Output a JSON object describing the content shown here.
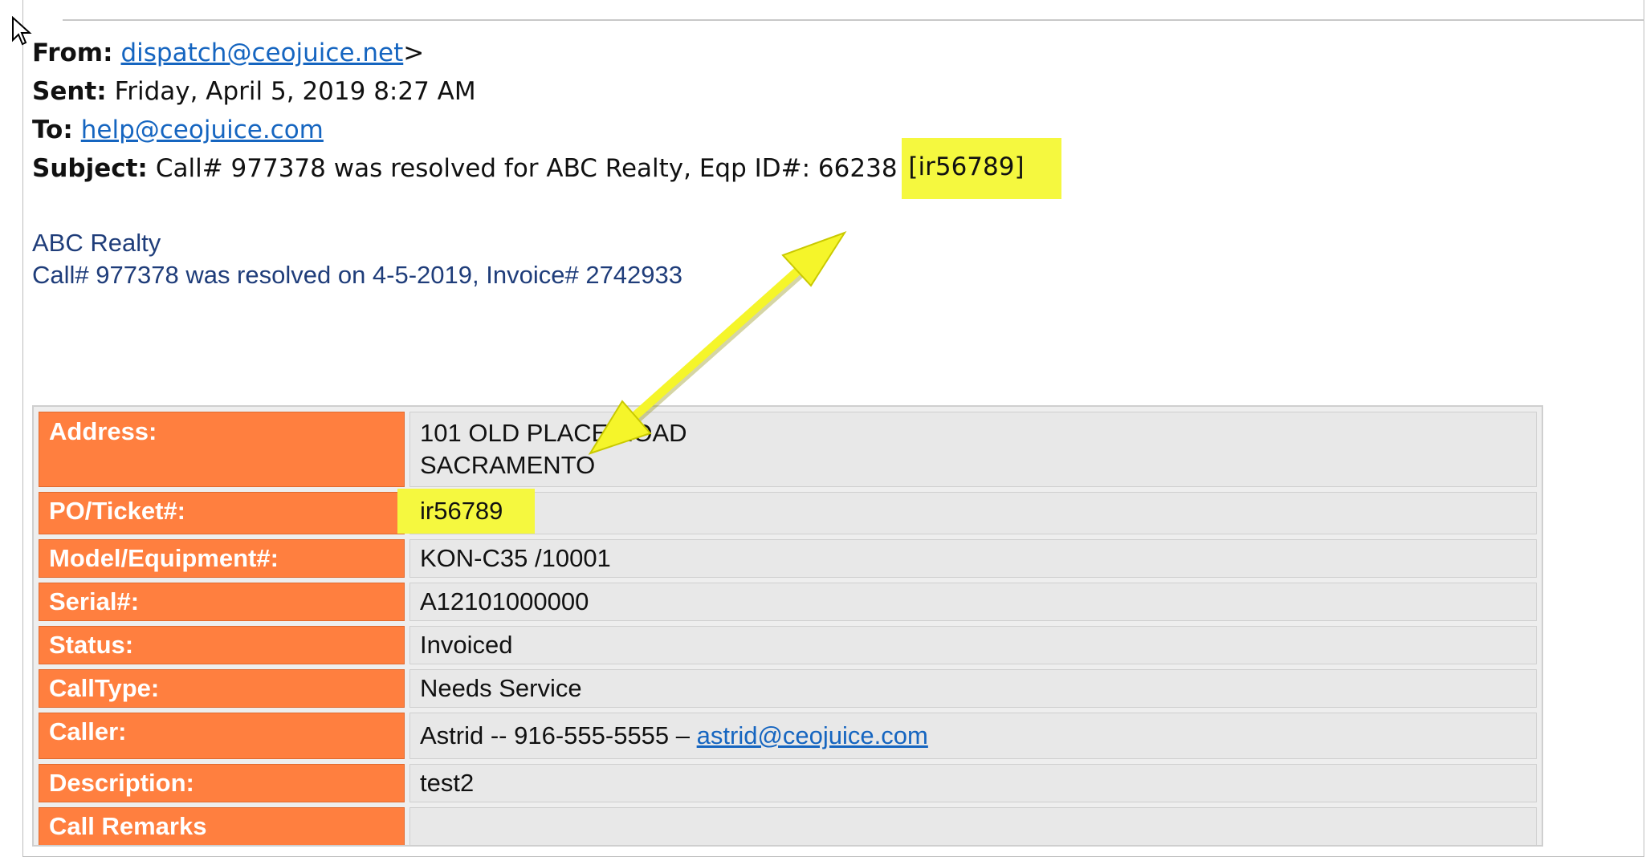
{
  "email": {
    "from_label": "From:",
    "from_email": "dispatch@ceojuice.net",
    "from_suffix": ">",
    "sent_label": "Sent:",
    "sent_value": "Friday, April 5, 2019 8:27 AM",
    "to_label": "To:",
    "to_email": "help@ceojuice.com",
    "subject_label": "Subject:",
    "subject_text": "Call# 977378 was resolved for ABC Realty, Eqp ID#: 66238",
    "subject_tag": "[ir56789]"
  },
  "body": {
    "company": "ABC Realty",
    "summary": "Call# 977378 was resolved on 4-5-2019, Invoice# 2742933"
  },
  "details": {
    "address_label": "Address:",
    "address_line1": "101 OLD PLACE ROAD",
    "address_line2": "SACRAMENTO",
    "po_label": "PO/Ticket#:",
    "po_value": "ir56789",
    "model_label": "Model/Equipment#:",
    "model_value": "KON-C35 /10001",
    "serial_label": "Serial#:",
    "serial_value": "A12101000000",
    "status_label": "Status:",
    "status_value": "Invoiced",
    "calltype_label": "CallType:",
    "calltype_value": "Needs Service",
    "caller_label": "Caller:",
    "caller_text": "Astrid -- 916-555-5555 –",
    "caller_email": "astrid@ceojuice.com",
    "description_label": "Description:",
    "description_value": "test2",
    "remarks_label": "Call Remarks",
    "remarks_value": ""
  },
  "colors": {
    "label_bg": "#ff7f3f",
    "highlight": "#f5f83f",
    "link": "#1565c0",
    "intro_text": "#1f3d7a"
  },
  "icons": [
    "mouse-pointer-icon",
    "double-arrow-annotation"
  ]
}
